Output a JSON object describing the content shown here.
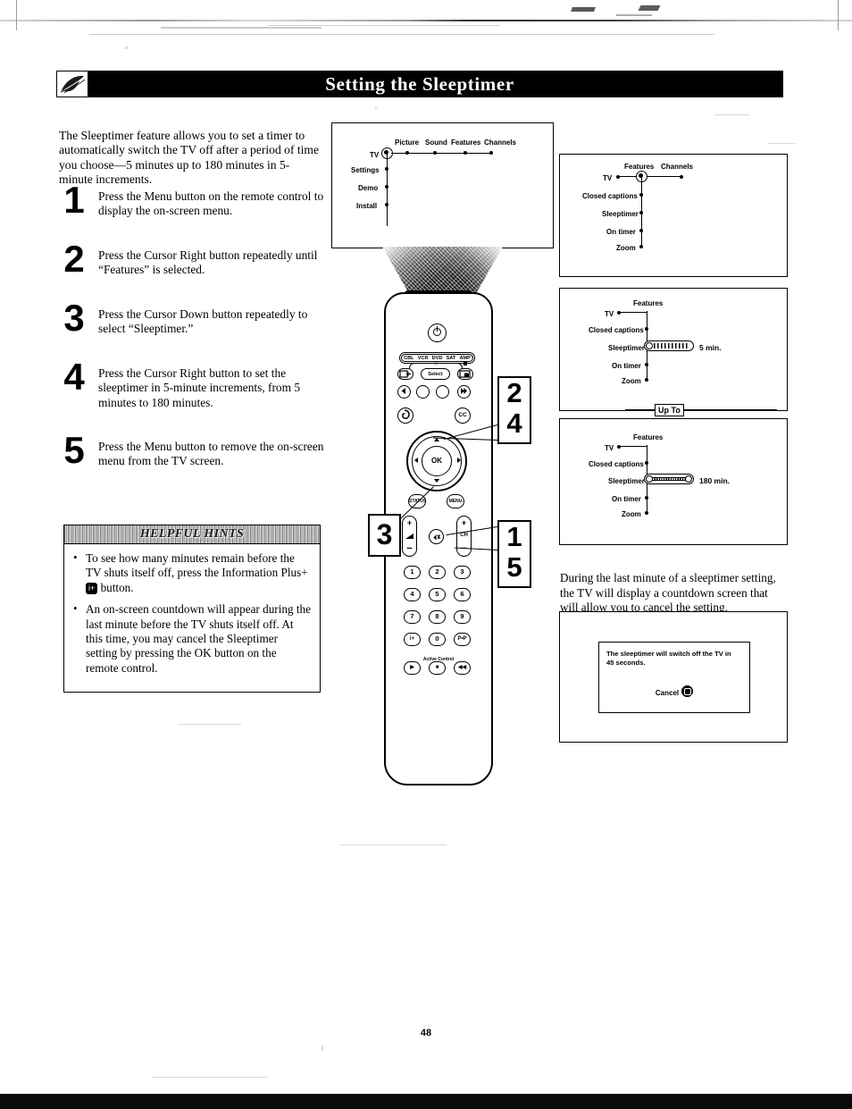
{
  "page": {
    "title": "Setting the Sleeptimer",
    "number": "48",
    "emblem_icon": "feather-quill-icon"
  },
  "intro": {
    "paragraph": "The Sleeptimer feature allows you to set a timer to automatically switch the TV off after a period of time you choose—5 minutes up to 180 minutes in 5-minute increments."
  },
  "steps": [
    {
      "num": "1",
      "text": "Press the Menu button on the remote control to display the on-screen menu."
    },
    {
      "num": "2",
      "text": "Press the Cursor Right button repeatedly until “Features” is selected."
    },
    {
      "num": "3",
      "text": "Press the Cursor Down button repeatedly to select “Sleeptimer.”"
    },
    {
      "num": "4",
      "text": "Press the Cursor Right button to set the sleeptimer in 5-minute increments, from 5 minutes to 180 minutes."
    },
    {
      "num": "5",
      "text": "Press the Menu button to remove the on-screen menu from the TV screen."
    }
  ],
  "hints": {
    "title": "HELPFUL HINTS",
    "bullet": "•",
    "items": [
      {
        "part1": "To see how many minutes remain before the TV shuts itself off, press the Information Plus+",
        "key": "i+",
        "part2": "button."
      },
      {
        "part1": "An on-screen countdown will appear during the last minute before the TV shuts itself off. At this time, you may cancel the Sleeptimer setting by pressing the OK button on the remote control.",
        "key": "",
        "part2": ""
      }
    ]
  },
  "screens": {
    "main_menu": {
      "root": "TV",
      "top_items": [
        "Picture",
        "Sound",
        "Features",
        "Channels"
      ],
      "side_items": [
        "Settings",
        "Demo",
        "Install"
      ]
    },
    "features_menu": {
      "root": "TV",
      "top_items": [
        "Features",
        "Channels"
      ],
      "side_items": [
        "Closed captions",
        "Sleeptimer",
        "On timer",
        "Zoom"
      ]
    },
    "sleeptimer_5min": {
      "root": "TV",
      "top_items": [
        "Features"
      ],
      "side_items": [
        "Closed captions",
        "Sleeptimer",
        "On timer",
        "Zoom"
      ],
      "slider_value": "5 min."
    },
    "sleeptimer_180min": {
      "root": "TV",
      "top_items": [
        "Features"
      ],
      "side_items": [
        "Closed captions",
        "Sleeptimer",
        "On timer",
        "Zoom"
      ],
      "slider_value": "180 min."
    },
    "up_to_badge": "Up To",
    "countdown": {
      "caption": "During the last minute of a sleeptimer setting, the TV will display a countdown screen that will allow you to cancel the setting.",
      "message": "The sleeptimer will switch off the TV in 45 seconds.",
      "cancel_label": "Cancel",
      "cancel_icon": "ok-button-icon"
    }
  },
  "remote": {
    "power_icon": "power-icon",
    "devices": [
      "CBL",
      "VCR",
      "DVD",
      "SAT",
      "AMP"
    ],
    "select_label": "Select",
    "select_star_icon": "star-icon",
    "source_icon": "source-input-icon",
    "pip_icon": "pip-icon",
    "record_icon": "record-dot-icon",
    "rewind_icon": "rewind-icon",
    "stop_icon": "stop-icon",
    "play_icon": "play-icon",
    "forward_icon": "fast-forward-icon",
    "surf_icon": "surf-swirl-icon",
    "cc_label": "CC",
    "ok_label": "OK",
    "menu_label": "MENU",
    "status_label": "STATUS",
    "volume_label": "VOL",
    "channel_label": "CH",
    "mute_icon": "mute-icon",
    "plus": "+",
    "minus": "−",
    "numpad": [
      "1",
      "2",
      "3",
      "4",
      "5",
      "6",
      "7",
      "8",
      "9",
      "i+",
      "0",
      "P•P"
    ],
    "active_control_label": "Active Control",
    "bottom_row": [
      "▶",
      "■",
      "◀◀"
    ]
  },
  "callouts": [
    {
      "id": "callout-24",
      "lines": [
        "2",
        "4"
      ]
    },
    {
      "id": "callout-15",
      "lines": [
        "1",
        "5"
      ]
    },
    {
      "id": "callout-3",
      "lines": [
        "3"
      ]
    }
  ],
  "colors": {
    "ink": "#000000",
    "paper": "#ffffff",
    "banner": "#000000",
    "banner_text": "#ffffff"
  }
}
